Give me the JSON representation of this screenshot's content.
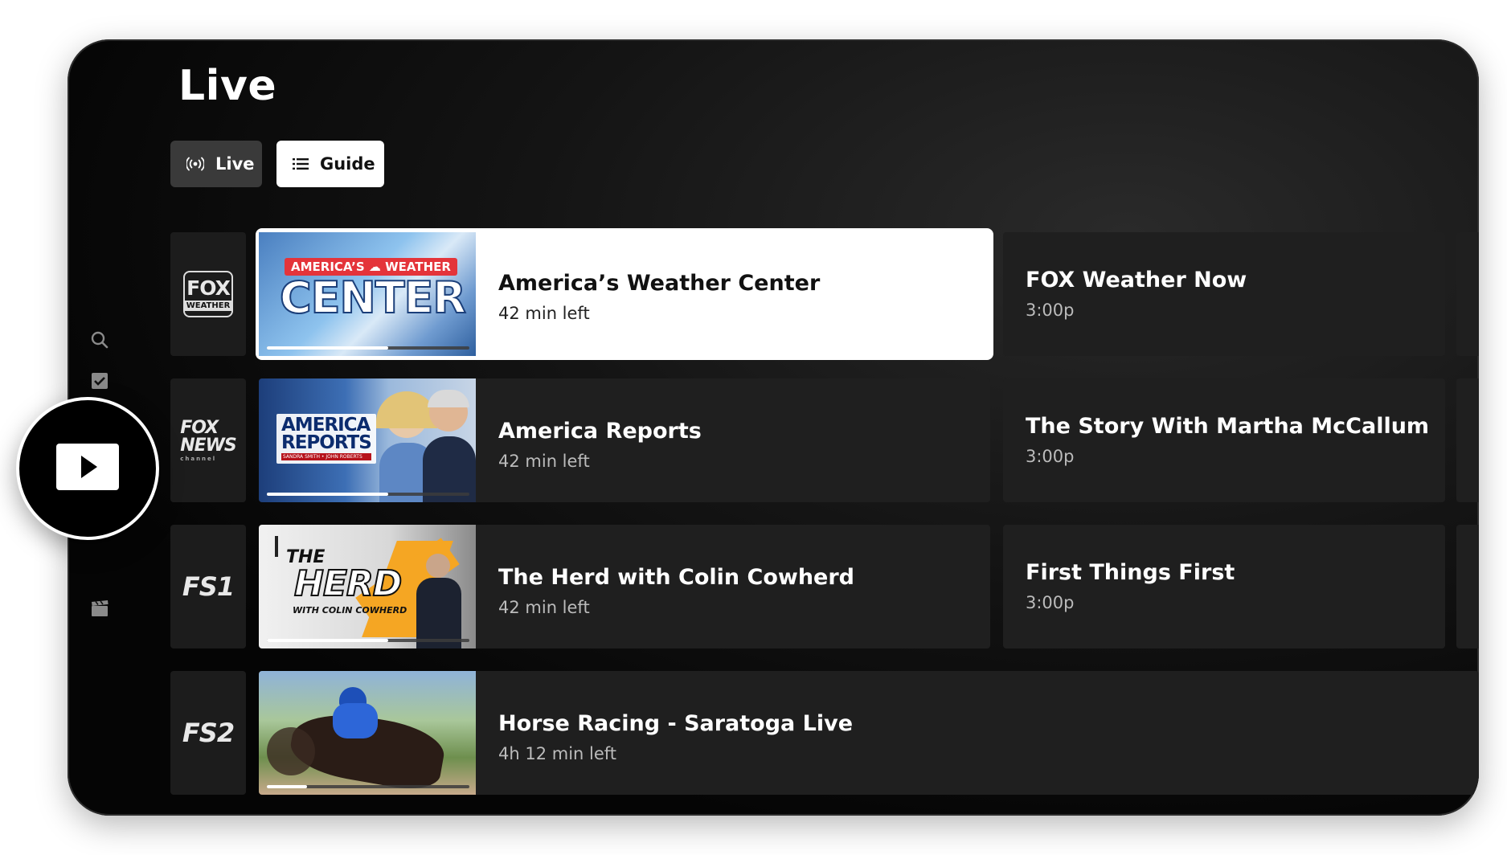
{
  "header": {
    "title": "Live"
  },
  "tabs": [
    {
      "label": "Live",
      "icon": "broadcast-icon",
      "selected": true
    },
    {
      "label": "Guide",
      "icon": "list-icon",
      "selected": false
    }
  ],
  "sidebar": {
    "icons": [
      "search-icon",
      "checkbox-icon",
      "home-icon",
      "clapperboard-icon"
    ]
  },
  "fab": {
    "icon": "play-icon"
  },
  "rows": [
    {
      "channel_logo": {
        "line1": "FOX",
        "line2": "WEATHER"
      },
      "current": {
        "title": "America’s Weather Center",
        "subtitle": "42 min left",
        "progress": 0.6,
        "thumb_text": {
          "top": "AMERICA’S",
          "top2": "WEATHER",
          "main": "CENTER"
        }
      },
      "next": {
        "title": "FOX Weather Now",
        "time": "3:00p"
      }
    },
    {
      "channel_logo": {
        "line1": "FOX",
        "line2": "NEWS",
        "line3": "channel"
      },
      "current": {
        "title": "America Reports",
        "subtitle": "42 min left",
        "progress": 0.6,
        "thumb_text": {
          "main": "AMERICA",
          "main2": "REPORTS",
          "sub": "SANDRA SMITH • JOHN ROBERTS"
        }
      },
      "next": {
        "title": "The Story With Martha McCallum",
        "time": "3:00p"
      }
    },
    {
      "channel_logo": {
        "line1": "FS1"
      },
      "current": {
        "title": "The Herd with Colin Cowherd",
        "subtitle": "42 min left",
        "progress": 0.6,
        "thumb_text": {
          "top": "THE",
          "main": "HERD",
          "sub": "WITH COLIN COWHERD"
        }
      },
      "next": {
        "title": "First Things First",
        "time": "3:00p"
      }
    },
    {
      "channel_logo": {
        "line1": "FS2"
      },
      "current": {
        "title": "Horse Racing - Saratoga Live",
        "subtitle": "4h 12 min left",
        "progress": 0.2
      }
    }
  ],
  "colors": {
    "background": "#000000",
    "card": "#1f1f1f",
    "focused_card": "#ffffff",
    "accent_orange": "#f5a623",
    "weather_red": "#e4343a"
  }
}
